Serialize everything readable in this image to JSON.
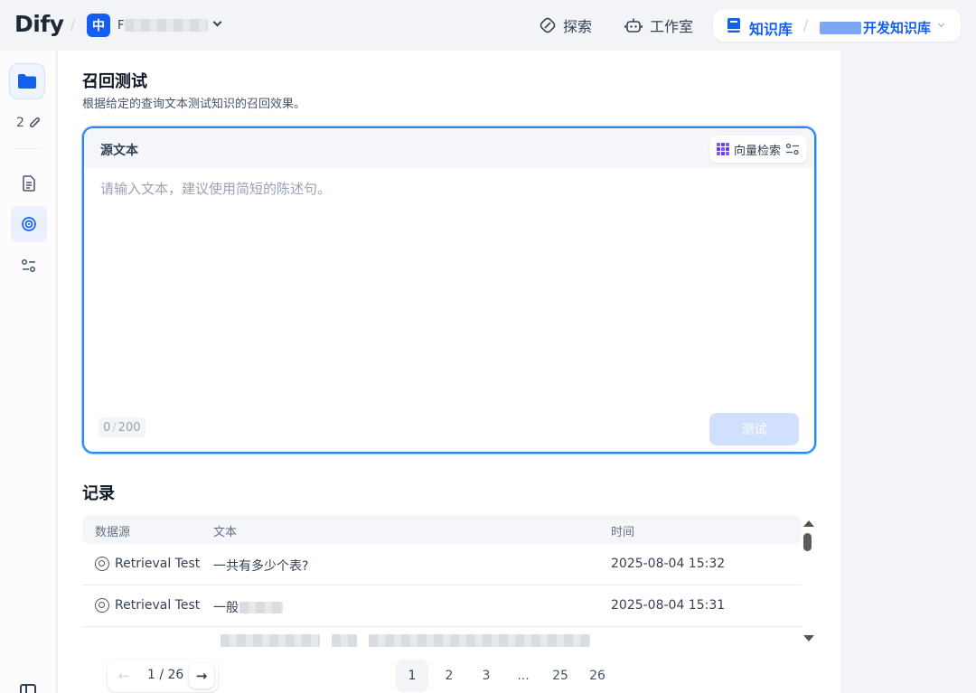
{
  "header": {
    "logo": "Dify",
    "workspace": {
      "avatar": "中",
      "name_first": "F"
    },
    "nav": {
      "explore": "探索",
      "studio": "工作室",
      "knowledge": "知识库",
      "current_kb_suffix": "开发知识库"
    }
  },
  "sidebar": {
    "doc_count": "2"
  },
  "page": {
    "title": "召回测试",
    "description": "根据给定的查询文本测试知识的召回效果。"
  },
  "query": {
    "source_label": "源文本",
    "retrieval_method": "向量检索",
    "placeholder": "请输入文本，建议使用简短的陈述句。",
    "count_current": "0",
    "count_max": "200",
    "test_button": "测试"
  },
  "records": {
    "title": "记录",
    "columns": [
      "数据源",
      "文本",
      "时间"
    ],
    "rows": [
      {
        "source": "Retrieval Test",
        "text": "一共有多少个表?",
        "time": "2025-08-04 15:32"
      },
      {
        "source": "Retrieval Test",
        "text": "一般",
        "time": "2025-08-04 15:31"
      }
    ]
  },
  "pagination": {
    "display": "1 / 26",
    "pages": [
      "1",
      "2",
      "3",
      "...",
      "25",
      "26"
    ],
    "current": "1"
  },
  "colors": {
    "accent": "#155eef",
    "focus_border": "#2f84f0",
    "disabled_button": "#d1e0ff"
  }
}
